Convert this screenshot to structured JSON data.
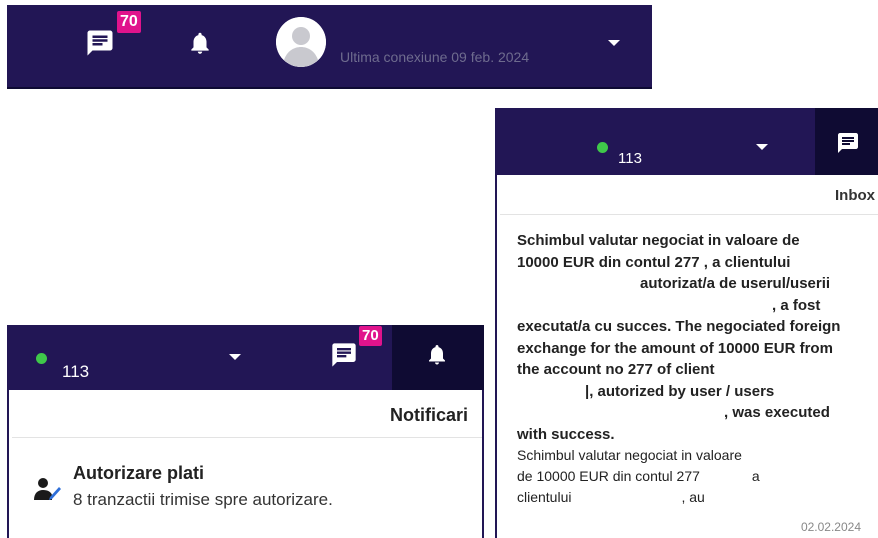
{
  "top_header": {
    "messages_badge": "70",
    "last_connection": "Ultima conexiune 09 feb. 2024"
  },
  "inbox_panel": {
    "online_count": "113",
    "title": "Inbox",
    "message_bold_lines": [
      "Schimbul valutar negociat in valoare de",
      "10000 EUR din contul 277        , a clientului",
      "autorizat/a de userul/userii",
      ", a fost",
      "executat/a cu succes. The negociated foreign",
      "exchange for the amount of 10000 EUR from",
      "the account no 277        of client",
      "|, autorized by user / users",
      ", was executed",
      "with success."
    ],
    "message_normal_lines": [
      "Schimbul valutar negociat in valoare",
      "de 10000 EUR din contul 277",
      "a",
      "clientului",
      ", au"
    ],
    "date": "02.02.2024"
  },
  "notif_panel": {
    "online_count": "113",
    "messages_badge": "70",
    "title": "Notificari",
    "item_title": "Autorizare plati",
    "item_desc": "8 tranzactii trimise spre autorizare."
  },
  "colors": {
    "navy": "#221655",
    "active_tab": "#0f0b33",
    "badge": "#e0138c",
    "online": "#3fc84a"
  },
  "icons": [
    "message-icon",
    "bell-icon",
    "avatar-icon",
    "chevron-down-icon",
    "user-sign-icon"
  ]
}
